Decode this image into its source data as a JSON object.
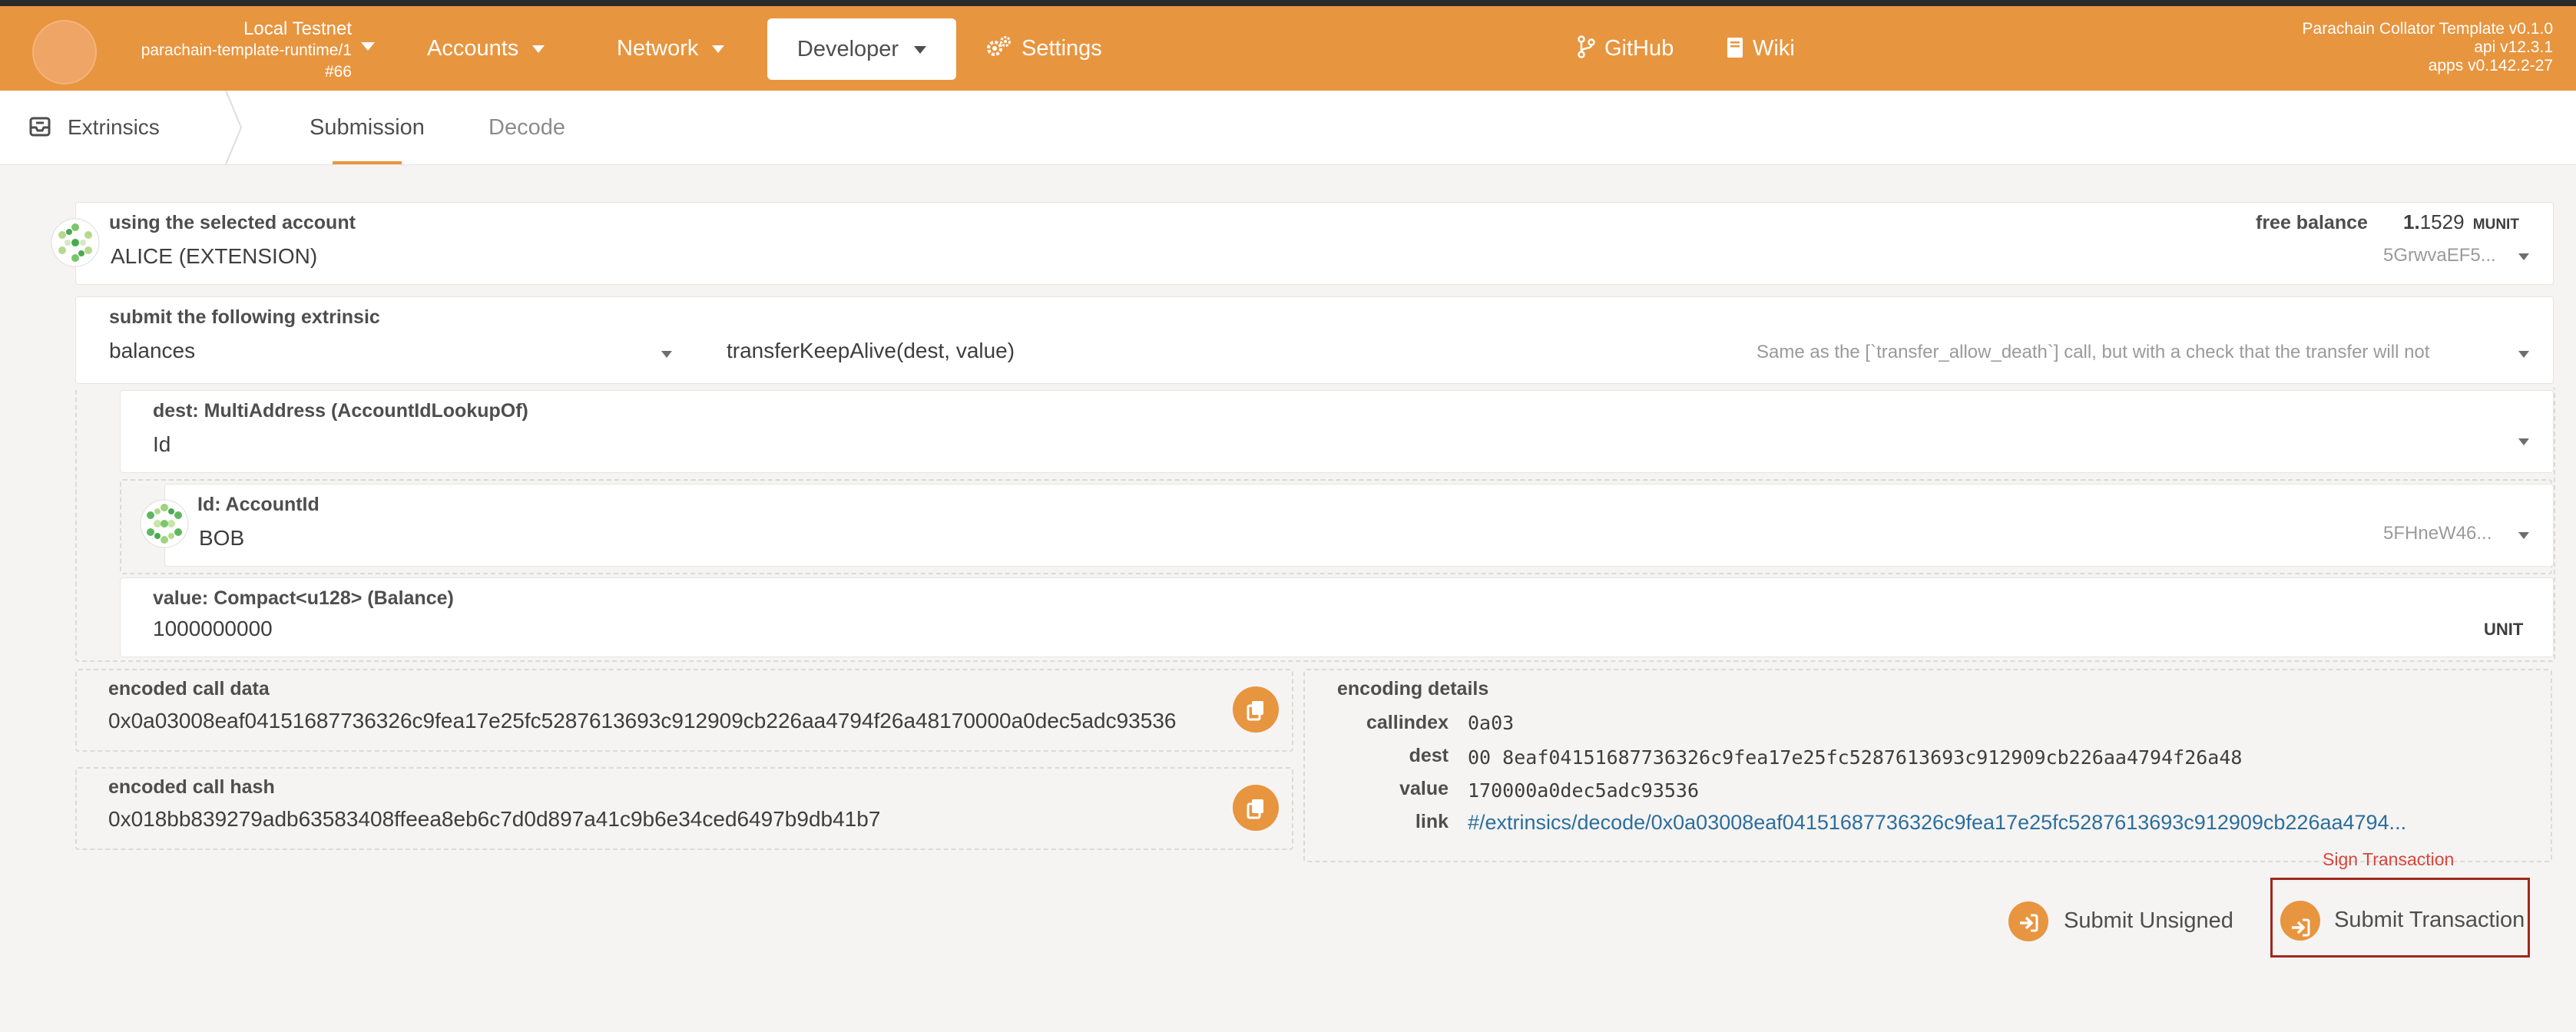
{
  "header": {
    "network_name": "Local Testnet",
    "runtime": "parachain-template-runtime/1",
    "block": "#66",
    "nav": {
      "accounts": "Accounts",
      "network": "Network",
      "developer": "Developer",
      "settings": "Settings",
      "github": "GitHub",
      "wiki": "Wiki"
    },
    "versions": {
      "template": "Parachain Collator Template v0.1.0",
      "api": "api v12.3.1",
      "apps": "apps v0.142.2-27"
    }
  },
  "subnav": {
    "section": "Extrinsics",
    "tabs": [
      "Submission",
      "Decode"
    ],
    "active_tab": "Submission"
  },
  "account": {
    "label": "using the selected account",
    "name": "ALICE (EXTENSION)",
    "balance_label": "free balance",
    "balance_int": "1.",
    "balance_dec": "1529",
    "balance_unit": "MUNIT",
    "address": "5GrwvaEF5..."
  },
  "extrinsic": {
    "label": "submit the following extrinsic",
    "pallet": "balances",
    "call": "transferKeepAlive(dest, value)",
    "description": "Same as the [`transfer_allow_death`] call, but with a check that the transfer will not"
  },
  "params": {
    "dest_label": "dest: MultiAddress (AccountIdLookupOf)",
    "dest_value": "Id",
    "id_label": "Id: AccountId",
    "id_value": "BOB",
    "id_address": "5FHneW46...",
    "value_label": "value: Compact<u128> (Balance)",
    "value_value": "1000000000",
    "value_unit": "UNIT"
  },
  "encoded": {
    "call_data_label": "encoded call data",
    "call_data": "0x0a03008eaf04151687736326c9fea17e25fc5287613693c912909cb226aa4794f26a48170000a0dec5adc93536",
    "call_hash_label": "encoded call hash",
    "call_hash": "0x018bb839279adb63583408ffeea8eb6c7d0d897a41c9b6e34ced6497b9db41b7"
  },
  "details": {
    "title": "encoding details",
    "callindex_label": "callindex",
    "callindex": "0a03",
    "dest_label": "dest",
    "dest_prefix": "00",
    "dest": "8eaf04151687736326c9fea17e25fc5287613693c912909cb226aa4794f26a48",
    "value_label": "value",
    "value": "170000a0dec5adc93536",
    "link_label": "link",
    "link": "#/extrinsics/decode/0x0a03008eaf04151687736326c9fea17e25fc5287613693c912909cb226aa4794..."
  },
  "actions": {
    "tooltip": "Sign Transaction",
    "submit_unsigned": "Submit Unsigned",
    "submit_transaction": "Submit Transaction"
  },
  "colors": {
    "accent": "#e8953f",
    "link": "#2c6e9c",
    "highlight_border": "#a0281c",
    "tooltip_text": "#d9453a"
  }
}
